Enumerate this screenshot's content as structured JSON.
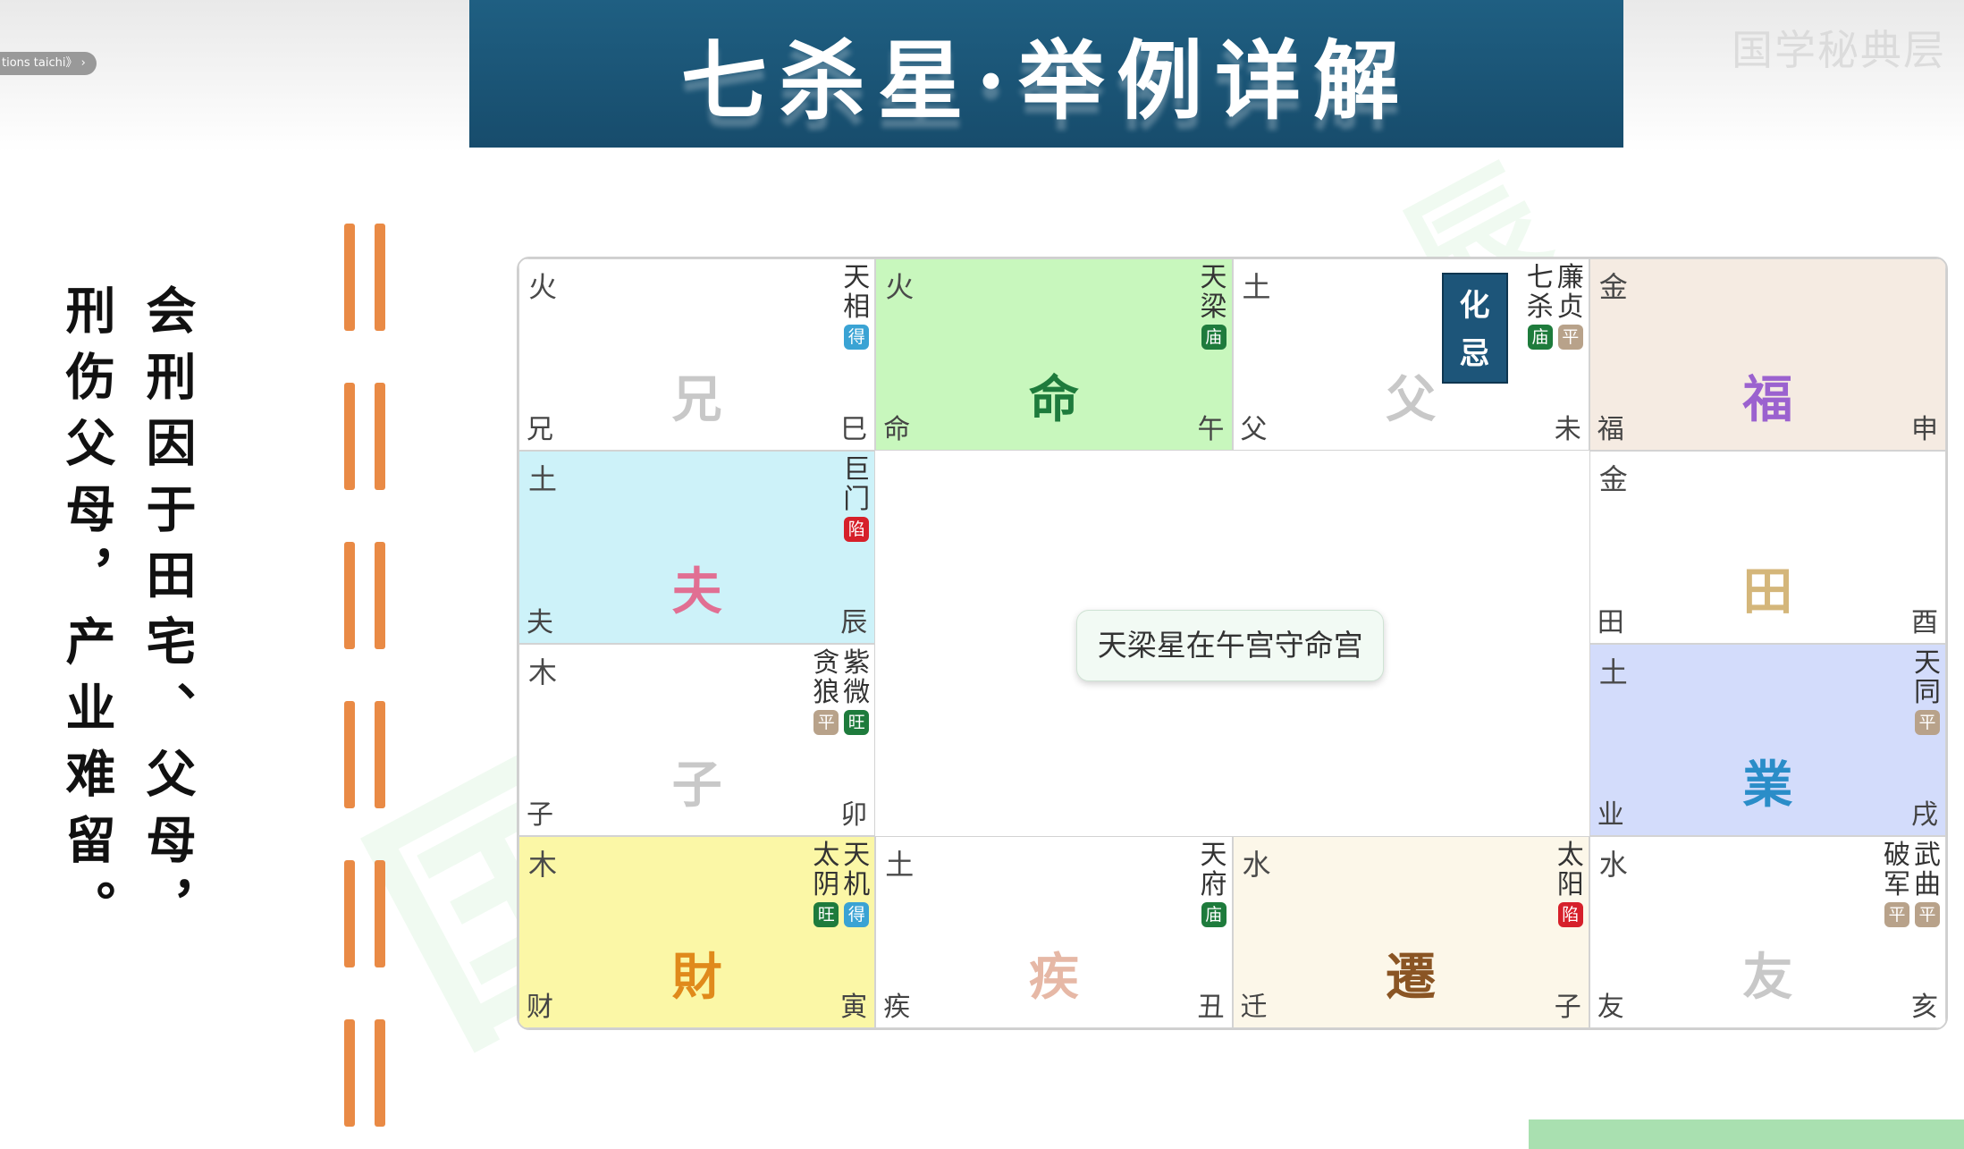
{
  "overlay": {
    "pill_text": "tions taichi》 ›",
    "corner_watermark": "国学秘典层"
  },
  "banner": {
    "title": "七杀星·举例详解"
  },
  "poem": {
    "text": "会刑因于田宅、父母，刑伤父母，产业难留。"
  },
  "chart": {
    "center_label": "天梁星在午宫守命宫",
    "hua": {
      "text": "化忌"
    },
    "colors": {
      "miao": "#1e7b3c",
      "wang": "#1e7b3c",
      "de": "#3aa3d4",
      "ping": "#b8a28a",
      "xian": "#d6202a"
    },
    "palaces": [
      {
        "element": "火",
        "big": "兄",
        "short": "兄",
        "branch": "巳",
        "bg": "#ffffff",
        "big_color": "#c8c8c8",
        "stars": [
          {
            "name": "天相",
            "badge": "得",
            "color": "#3aa3d4"
          }
        ]
      },
      {
        "element": "火",
        "big": "命",
        "short": "命",
        "branch": "午",
        "bg": "#c8f7bd",
        "big_color": "#1e7b3c",
        "stars": [
          {
            "name": "天梁",
            "badge": "庙",
            "color": "#1e7b3c"
          }
        ]
      },
      {
        "element": "土",
        "big": "父",
        "short": "父",
        "branch": "未",
        "bg": "#ffffff",
        "big_color": "#c8c8c8",
        "stars": [
          {
            "name": "廉贞",
            "badge": "平",
            "color": "#b8a28a"
          },
          {
            "name": "七杀",
            "badge": "庙",
            "color": "#1e7b3c"
          }
        ]
      },
      {
        "element": "金",
        "big": "福",
        "short": "福",
        "branch": "申",
        "bg": "#f5ebe2",
        "big_color": "#9b62cf",
        "stars": []
      },
      {
        "element": "土",
        "big": "夫",
        "short": "夫",
        "branch": "辰",
        "bg": "#cdf2f9",
        "big_color": "#e16f93",
        "stars": [
          {
            "name": "巨门",
            "badge": "陷",
            "color": "#d6202a"
          }
        ]
      },
      {
        "element": "金",
        "big": "田",
        "short": "田",
        "branch": "酉",
        "bg": "#ffffff",
        "big_color": "#d4b67a",
        "stars": []
      },
      {
        "element": "木",
        "big": "子",
        "short": "子",
        "branch": "卯",
        "bg": "#ffffff",
        "big_color": "#c8c8c8",
        "stars": [
          {
            "name": "紫微",
            "badge": "旺",
            "color": "#1e7b3c"
          },
          {
            "name": "贪狼",
            "badge": "平",
            "color": "#b8a28a"
          }
        ]
      },
      {
        "element": "土",
        "big": "業",
        "short": "业",
        "branch": "戌",
        "bg": "#d3dcfb",
        "big_color": "#2a8dc8",
        "stars": [
          {
            "name": "天同",
            "badge": "平",
            "color": "#b8a28a"
          }
        ]
      },
      {
        "element": "木",
        "big": "財",
        "short": "财",
        "branch": "寅",
        "bg": "#fbf7a6",
        "big_color": "#e08a1b",
        "stars": [
          {
            "name": "天机",
            "badge": "得",
            "color": "#3aa3d4"
          },
          {
            "name": "太阴",
            "badge": "旺",
            "color": "#1e7b3c"
          }
        ]
      },
      {
        "element": "土",
        "big": "疾",
        "short": "疾",
        "branch": "丑",
        "bg": "#ffffff",
        "big_color": "#e6b8a6",
        "stars": [
          {
            "name": "天府",
            "badge": "庙",
            "color": "#1e7b3c"
          }
        ]
      },
      {
        "element": "水",
        "big": "遷",
        "short": "迁",
        "branch": "子",
        "bg": "#fcf7e9",
        "big_color": "#8a5524",
        "stars": [
          {
            "name": "太阳",
            "badge": "陷",
            "color": "#d6202a"
          }
        ]
      },
      {
        "element": "水",
        "big": "友",
        "short": "友",
        "branch": "亥",
        "bg": "#ffffff",
        "big_color": "#c8c8c8",
        "stars": [
          {
            "name": "武曲",
            "badge": "平",
            "color": "#b8a28a"
          },
          {
            "name": "破军",
            "badge": "平",
            "color": "#b8a28a"
          }
        ]
      }
    ]
  }
}
